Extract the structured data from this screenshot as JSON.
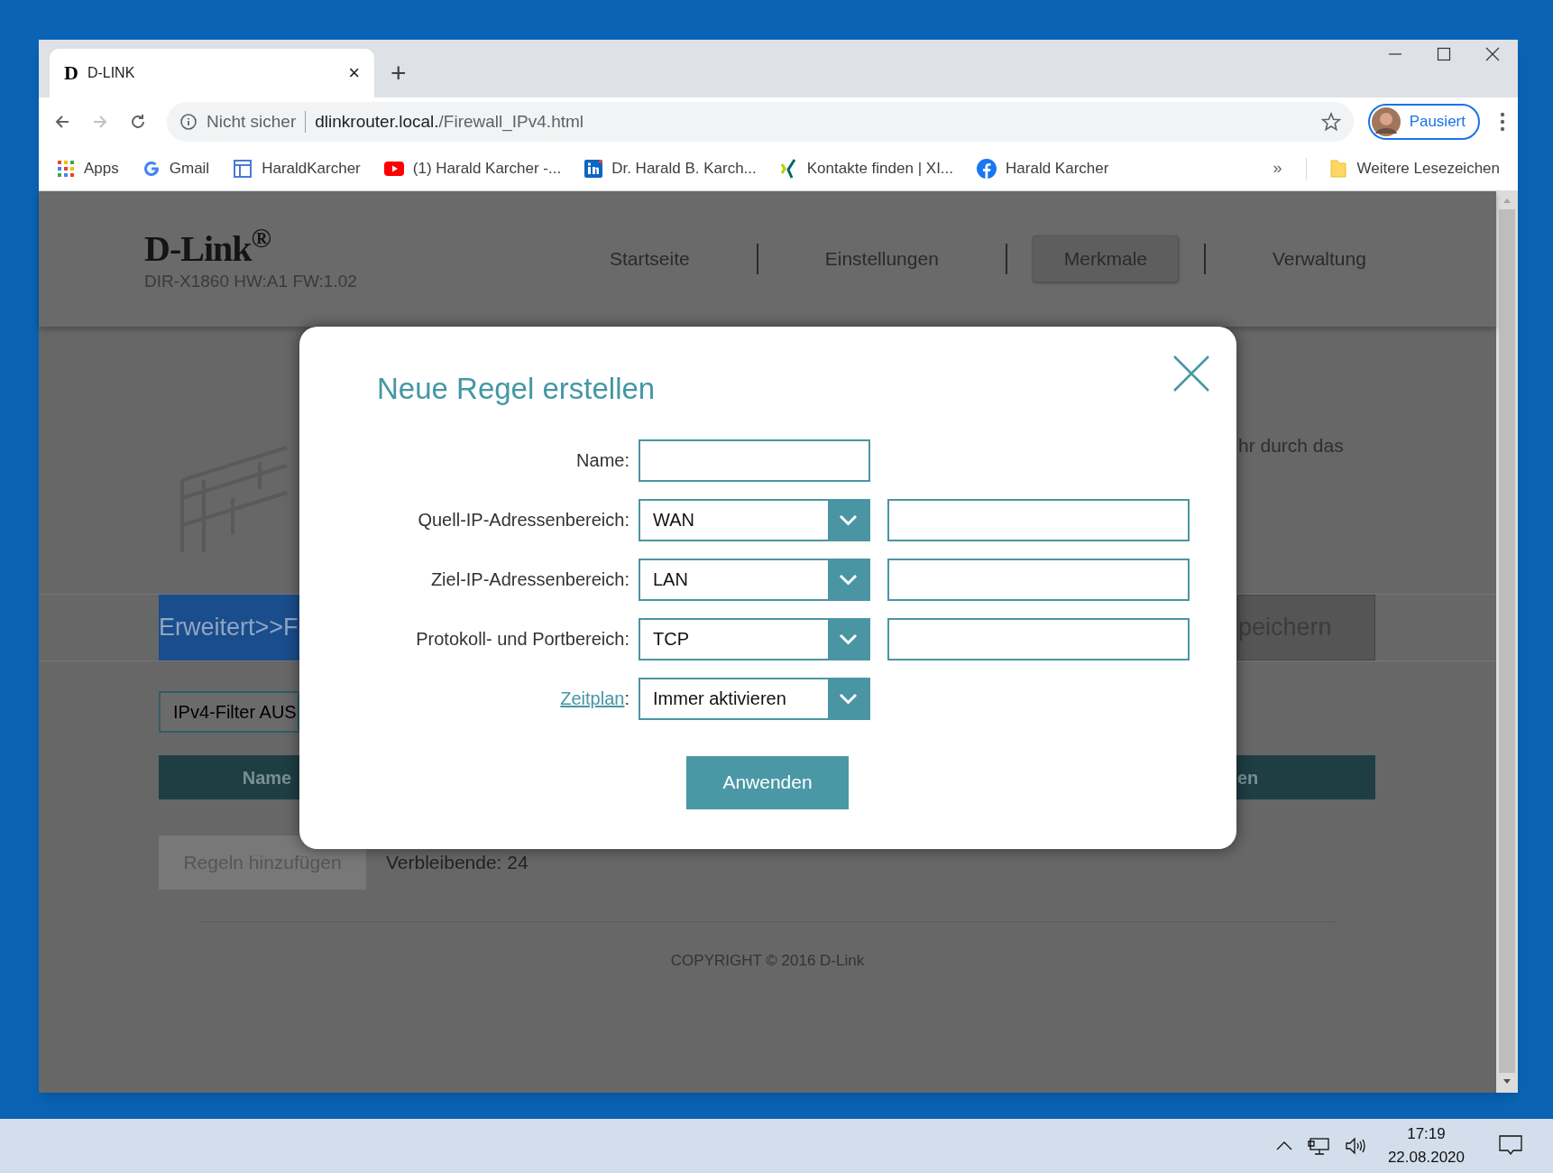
{
  "browser": {
    "tab": {
      "favicon": "D",
      "title": "D-LINK",
      "close": "×"
    },
    "new_tab": "+",
    "address": {
      "security": "Nicht sicher",
      "host": "dlinkrouter.local.",
      "path": "/Firewall_IPv4.html"
    },
    "profile": {
      "label": "Pausiert"
    },
    "bookmarks": [
      {
        "kind": "apps",
        "label": "Apps"
      },
      {
        "kind": "google",
        "label": "Gmail"
      },
      {
        "kind": "page",
        "label": "HaraldKarcher"
      },
      {
        "kind": "youtube",
        "label": "(1) Harald Karcher -..."
      },
      {
        "kind": "linkedin",
        "label": "Dr. Harald B. Karch..."
      },
      {
        "kind": "xing",
        "label": "Kontakte finden | XI..."
      },
      {
        "kind": "facebook",
        "label": "Harald Karcher"
      }
    ],
    "bookmarks_more": "»",
    "other_bookmarks": "Weitere Lesezeichen"
  },
  "page": {
    "logo": "D-Link$^{®}$",
    "model": "DIR-X1860 HW:A1 FW:1.02",
    "nav": [
      {
        "label": "Startseite",
        "selected": false
      },
      {
        "label": "Einstellungen",
        "selected": false
      },
      {
        "label": "Merkmale",
        "selected": true
      },
      {
        "label": "Verwaltung",
        "selected": false
      }
    ],
    "intro_text": "hr durch das",
    "breadcrumb": "Erweitert>>F",
    "save_button": "peichern",
    "filter_select": "IPv4-Filter AUS",
    "table_columns": [
      "Name",
      "en"
    ],
    "add_button": "Regeln hinzufügen",
    "remaining": "Verbleibende: 24",
    "copyright": "COPYRIGHT © 2016 D-Link"
  },
  "dialog": {
    "title": "Neue Regel erstellen",
    "fields": [
      {
        "kind": "text",
        "label": "Name:"
      },
      {
        "kind": "select_range",
        "label": "Quell-IP-Adressenbereich:",
        "value": "WAN"
      },
      {
        "kind": "select_range",
        "label": "Ziel-IP-Adressenbereich:",
        "value": "LAN"
      },
      {
        "kind": "select_range",
        "label": "Protokoll- und Portbereich:",
        "value": "TCP"
      },
      {
        "kind": "link_select",
        "label": "Zeitplan",
        "suffix": ":",
        "value": "Immer aktivieren"
      }
    ],
    "apply_button": "Anwenden"
  },
  "taskbar": {
    "time": "17:19",
    "date": "22.08.2020"
  }
}
